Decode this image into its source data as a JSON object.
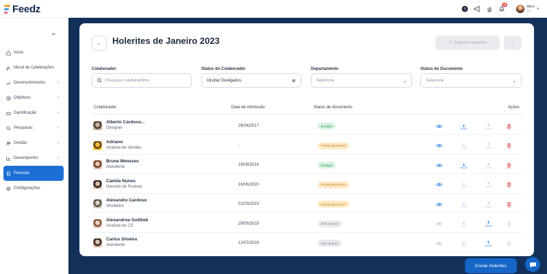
{
  "brand": {
    "name": "Feedz",
    "colors": [
      "#f0a030",
      "#3aa3e0",
      "#e05a7a"
    ]
  },
  "topbar": {
    "notification_count": "99",
    "user": {
      "name": "Alice",
      "role": "CS"
    }
  },
  "sidebar": {
    "items": [
      {
        "label": "Início",
        "icon": "home-icon",
        "chevron": false
      },
      {
        "label": "Mural de Celebrações",
        "icon": "celebration-icon",
        "chevron": false
      },
      {
        "label": "Desenvolvimento",
        "icon": "development-icon",
        "chevron": true
      },
      {
        "label": "Objetivos",
        "icon": "target-icon",
        "chevron": true
      },
      {
        "label": "Gamificação",
        "icon": "gamification-icon",
        "chevron": true
      },
      {
        "label": "Pesquisas",
        "icon": "search-icon",
        "chevron": true
      },
      {
        "label": "Gestão",
        "icon": "people-icon",
        "chevron": true
      },
      {
        "label": "Desempenho",
        "icon": "chart-icon",
        "chevron": true
      },
      {
        "label": "Pessoas",
        "icon": "document-icon",
        "chevron": false,
        "active": true
      },
      {
        "label": "Configurações",
        "icon": "gear-icon",
        "chevron": false
      }
    ]
  },
  "page": {
    "title": "Holerites de Janeiro 2023",
    "import_label": "Importar Holerites",
    "more_label": "⋮"
  },
  "filters": {
    "colaborador": {
      "label": "Colaborador",
      "placeholder": "Pesquise colaboradores"
    },
    "status_colaborador": {
      "label": "Status do Colaborador",
      "value": "Ocultar Desligados"
    },
    "departamento": {
      "label": "Departamento",
      "placeholder": "Selecione"
    },
    "status_documento": {
      "label": "Status do Documento",
      "placeholder": "Selecione"
    }
  },
  "table": {
    "headers": {
      "colaborador": "Colaborador",
      "admissao": "Data de Admissão",
      "status": "Status de documento",
      "acoes": "Ações"
    },
    "rows": [
      {
        "name": "Alberto Cardoso...",
        "role": "Designer",
        "date": "26/04/2017",
        "status": "Enviado",
        "tone": "green",
        "upload_active": false
      },
      {
        "name": "Adriano",
        "role": "Analista de Vendas",
        "date": "-",
        "status": "Pronto para envio",
        "tone": "yellow",
        "upload_active": false
      },
      {
        "name": "Bruna Menezes",
        "role": "Atendente",
        "date": "19/09/2014",
        "status": "Enviado",
        "tone": "green",
        "upload_active": false
      },
      {
        "name": "Camila Nunes",
        "role": "Gerente de Produto",
        "date": "16/06/2020",
        "status": "Pronto para envio",
        "tone": "yellow",
        "upload_active": false
      },
      {
        "name": "Alexandre Cardoso",
        "role": "Vendedor",
        "date": "01/03/2023",
        "status": "Pronto para envio",
        "tone": "yellow",
        "upload_active": false
      },
      {
        "name": "Alexandrea Gottlieb",
        "role": "Analista de CS",
        "date": "29/05/2019",
        "status": "Sem arquivo",
        "tone": "gray",
        "upload_active": true
      },
      {
        "name": "Carlos Silveira",
        "role": "Atendente",
        "date": "12/07/2019",
        "status": "Sem arquivo",
        "tone": "gray",
        "upload_active": true
      }
    ]
  },
  "footer": {
    "send_label": "Enviar Holerites"
  }
}
